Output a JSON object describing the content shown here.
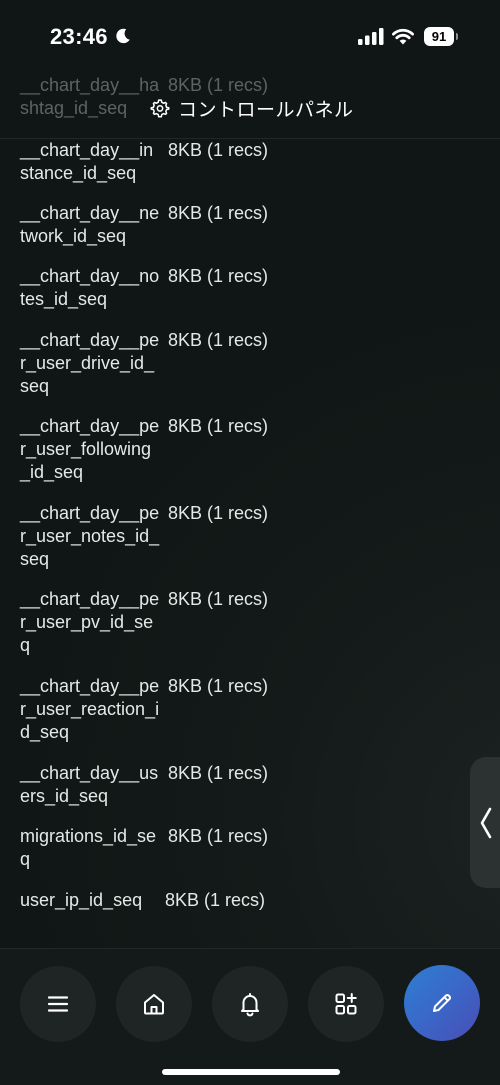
{
  "status_bar": {
    "time": "23:46",
    "battery": "91"
  },
  "header": {
    "title": "コントロールパネル"
  },
  "rows": [
    {
      "name": "__chart_day__hashtag_id_seq",
      "size": "8KB (1 recs)"
    },
    {
      "name": "__chart_day__instance_id_seq",
      "size": "8KB (1 recs)"
    },
    {
      "name": "__chart_day__network_id_seq",
      "size": "8KB (1 recs)"
    },
    {
      "name": "__chart_day__notes_id_seq",
      "size": "8KB (1 recs)"
    },
    {
      "name": "__chart_day__per_user_drive_id_seq",
      "size": "8KB (1 recs)"
    },
    {
      "name": "__chart_day__per_user_following_id_seq",
      "size": "8KB (1 recs)"
    },
    {
      "name": "__chart_day__per_user_notes_id_seq",
      "size": "8KB (1 recs)"
    },
    {
      "name": "__chart_day__per_user_pv_id_seq",
      "size": "8KB (1 recs)"
    },
    {
      "name": "__chart_day__per_user_reaction_id_seq",
      "size": "8KB (1 recs)"
    },
    {
      "name": "__chart_day__users_id_seq",
      "size": "8KB (1 recs)"
    },
    {
      "name": "migrations_id_seq",
      "size": "8KB (1 recs)"
    },
    {
      "name": "user_ip_id_seq",
      "size": "8KB (1 recs)"
    }
  ],
  "colors": {
    "accent_start": "#2e7fd2",
    "accent_end": "#4b4db4",
    "background": "#101615"
  },
  "icons": {
    "moon": "moon-icon",
    "signal": "signal-icon",
    "wifi": "wifi-icon",
    "gear": "gear-icon",
    "menu": "menu-icon",
    "home": "home-icon",
    "bell": "bell-icon",
    "widgets": "widgets-icon",
    "compose": "pencil-icon",
    "handle": "chevron-left-icon"
  }
}
